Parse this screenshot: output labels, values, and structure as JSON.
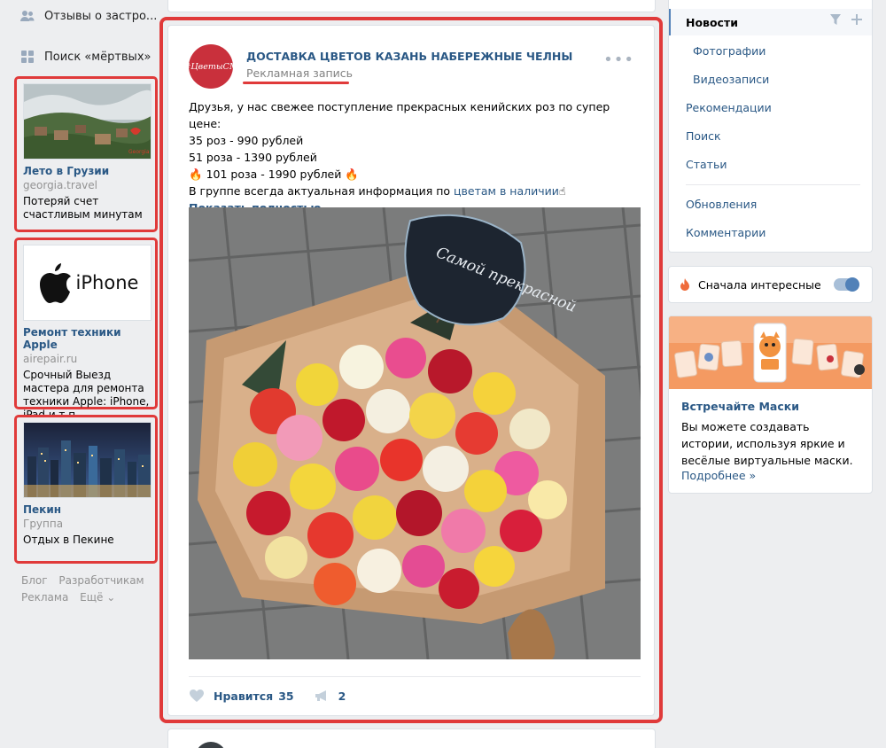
{
  "left_nav": {
    "reviews": "Отзывы о застро...",
    "search_dead": "Поиск «мёртвых»"
  },
  "ads": [
    {
      "title": "Лето в Грузии",
      "sub": "georgia.travel",
      "desc": "Потеряй счет счастливым минутам"
    },
    {
      "title": "Ремонт техники Apple",
      "sub": "airepair.ru",
      "desc": "Срочный Выезд мастера для ремонта техники Apple: iPhone, iPad и т.п.",
      "pic_text": "iPhone"
    },
    {
      "title": "Пекин",
      "sub": "Группа",
      "desc": "Отдых в Пекине"
    }
  ],
  "footer": {
    "blog": "Блог",
    "dev": "Разработчикам",
    "ads": "Реклама",
    "more": "Ещё ⌄"
  },
  "post": {
    "avatar_text": "#ЦветыСМ",
    "author": "ДОСТАВКА ЦВЕТОВ КАЗАНЬ НАБЕРЕЖНЫЕ ЧЕЛНЫ",
    "ad_label": "Рекламная запись",
    "more": "•••",
    "text_line1": "Друзья, у нас свежее поступление прекрасных кенийских роз по супер цене:",
    "text_line2": "35 роз - 990 рублей",
    "text_line3": "51 роза - 1390 рублей",
    "text_line4": "101 роза - 1990 рублей",
    "text_line5_a": "В группе всегда актуальная информация по ",
    "text_line5_link": "цветам в наличии",
    "show_more": "Показать полностью…",
    "sign_text": "Самой прекрасной",
    "like_label": "Нравится",
    "like_count": "35",
    "share_count": "2"
  },
  "right_menu": {
    "news": "Новости",
    "photos": "Фотографии",
    "videos": "Видеозаписи",
    "recommendations": "Рекомендации",
    "search": "Поиск",
    "articles": "Статьи",
    "updates": "Обновления",
    "comments": "Комментарии"
  },
  "interesting": {
    "label": "Сначала интересные",
    "enabled": true
  },
  "masks": {
    "title": "Встречайте Маски",
    "desc": "Вы можете создавать истории, используя яркие и весёлые виртуальные маски.",
    "link": "Подробнее »"
  },
  "colors": {
    "accent": "#e03a3a",
    "link": "#2a5885",
    "brand": "#5181b8",
    "background": "#edeef0"
  }
}
